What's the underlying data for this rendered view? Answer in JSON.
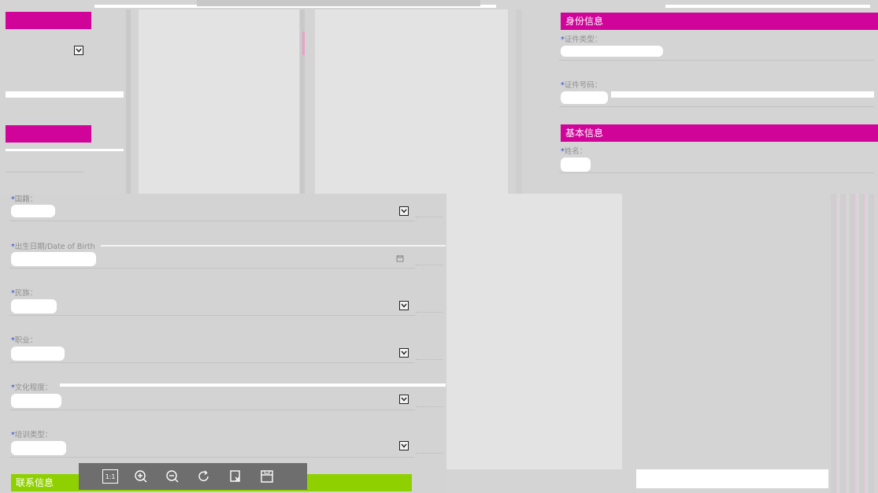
{
  "identity": {
    "header": "身份信息",
    "id_type_label": "证件类型：",
    "id_number_label": "证件号码："
  },
  "basic": {
    "header": "基本信息",
    "name_label": "姓名："
  },
  "form": {
    "required_mark": "*",
    "nationality_label": "国籍：",
    "dob_label": "出生日期/Date of Birth",
    "ethnicity_label": "民族：",
    "occupation_label": "职业：",
    "education_label": "文化程度：",
    "training_label": "培训类型："
  },
  "contact": {
    "header": "联系信息"
  },
  "toolbar": {
    "actual_size_label": "1:1",
    "icons": [
      "zoom-in-icon",
      "zoom-out-icon",
      "rotate-icon",
      "crop-icon",
      "save-icon"
    ]
  },
  "colors": {
    "section_header": "#d1049a",
    "contact_header": "#8fd100",
    "toolbar_bg": "#6e6e6e"
  }
}
